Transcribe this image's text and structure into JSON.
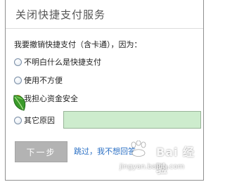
{
  "dialog": {
    "title": "关闭快捷支付服务"
  },
  "question": "我要撤销快捷支付（含卡通），因为：",
  "options": [
    {
      "label": "不明白什么是快捷支付",
      "selected": false
    },
    {
      "label": "使用不方便",
      "selected": false
    },
    {
      "label": "我担心资金安全",
      "selected": false,
      "hovered": true
    },
    {
      "label": "其它原因",
      "selected": false
    }
  ],
  "other_reason_input": {
    "value": "",
    "background_color": "#cdeccd"
  },
  "buttons": {
    "next_label": "下一步",
    "skip_label": "跳过，我不想回答"
  },
  "watermark": {
    "brand": "Bai 经验",
    "url": "jingyan.baidu.com"
  },
  "colors": {
    "link": "#2a6fc4",
    "button_disabled": "#b3b3b3",
    "input_fill": "#cdeccd"
  }
}
